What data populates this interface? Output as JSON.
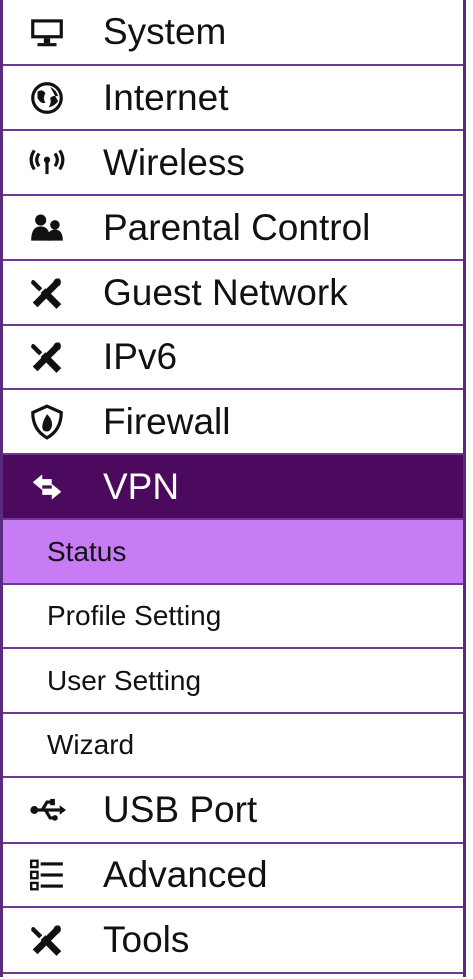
{
  "menu": {
    "items": [
      {
        "label": "System",
        "icon": "monitor-icon"
      },
      {
        "label": "Internet",
        "icon": "globe-icon"
      },
      {
        "label": "Wireless",
        "icon": "wireless-icon"
      },
      {
        "label": "Parental Control",
        "icon": "users-icon"
      },
      {
        "label": "Guest Network",
        "icon": "tools-icon"
      },
      {
        "label": "IPv6",
        "icon": "tools-icon"
      },
      {
        "label": "Firewall",
        "icon": "shield-fire-icon"
      },
      {
        "label": "VPN",
        "icon": "vpn-arrows-icon",
        "active": true
      },
      {
        "label": "USB Port",
        "icon": "usb-icon"
      },
      {
        "label": "Advanced",
        "icon": "list-icon"
      },
      {
        "label": "Tools",
        "icon": "tools-icon"
      }
    ],
    "vpn_submenu": [
      {
        "label": "Status",
        "selected": true
      },
      {
        "label": "Profile Setting"
      },
      {
        "label": "User Setting"
      },
      {
        "label": "Wizard"
      }
    ]
  },
  "colors": {
    "border": "#6a3a96",
    "active_bg": "#4b0a5e",
    "selected_bg": "#c77bf4",
    "text": "#111111",
    "active_text": "#ffffff"
  }
}
